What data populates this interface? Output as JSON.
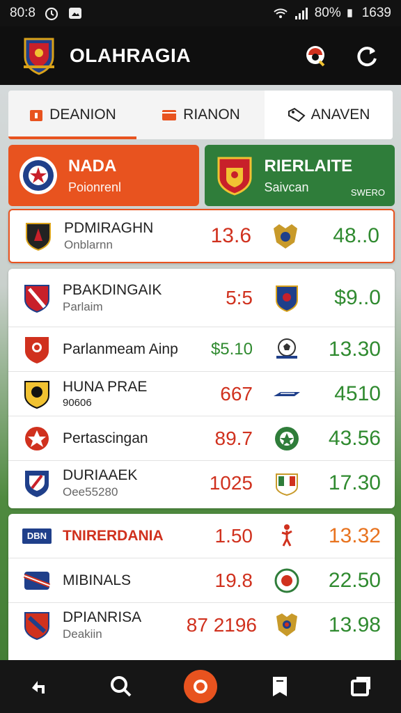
{
  "status_bar": {
    "time": "80:8",
    "battery": "80%",
    "clock_right": "1639",
    "icons": [
      "alarm-icon",
      "photo-icon",
      "wifi-icon",
      "signal-icon",
      "battery-icon"
    ]
  },
  "app_bar": {
    "title": "OLAHRAGIA",
    "actions": [
      "notification-icon",
      "refresh-icon"
    ]
  },
  "tabs": [
    {
      "label": "DEANION",
      "icon": "calendar-icon",
      "active": true
    },
    {
      "label": "RIANON",
      "icon": "ticket-icon",
      "active": false
    },
    {
      "label": "ANAVEN",
      "icon": "tag-icon",
      "active": false
    }
  ],
  "features": [
    {
      "title": "NADA",
      "subtitle": "Poionrenl",
      "color": "#e8531f"
    },
    {
      "title": "RIERLAITE",
      "subtitle": "Saivcan",
      "extra": "SWERO",
      "color": "#2f7d3a"
    }
  ],
  "highlight_row": {
    "name": "PDMIRAGHN",
    "sub": "Onblarnn",
    "odd_left": "13.6",
    "odd_right": "48..0"
  },
  "list_one": [
    {
      "name": "PBAKDINGAIK",
      "sub": "Parlaim",
      "odd_left": "5:5",
      "odd_right": "$9..0"
    },
    {
      "name": "Parlanmeam Ainp",
      "sub": "",
      "odd_left": "$5.10",
      "odd_right": "13.30"
    },
    {
      "name": "HUNA PRAE",
      "sub": "90606",
      "odd_left": "667",
      "odd_right": "4510"
    },
    {
      "name": "Pertascingan",
      "sub": "",
      "odd_left": "89.7",
      "odd_right": "43.56"
    },
    {
      "name": "DURIAAEK",
      "sub": "Oee55280",
      "odd_left": "1025",
      "odd_right": "17.30"
    }
  ],
  "list_two": [
    {
      "name": "TNIRERDANIA",
      "sub": "",
      "prefix": "DBN",
      "odd_left": "1.50",
      "odd_right": "13.32"
    },
    {
      "name": "MIBINALS",
      "sub": "",
      "odd_left": "19.8",
      "odd_right": "22.50"
    },
    {
      "name": "DPIANRISA",
      "sub": "Deakiin",
      "odd_left": "87  2196",
      "odd_right": "13.98"
    }
  ],
  "bottom_nav": [
    "back-icon",
    "search-icon",
    "record-icon",
    "bookmark-icon",
    "window-icon"
  ],
  "colors": {
    "accent": "#e8531f",
    "green": "#2f7d3a",
    "odd_red": "#d0311e",
    "odd_green": "#2f8a2f"
  }
}
